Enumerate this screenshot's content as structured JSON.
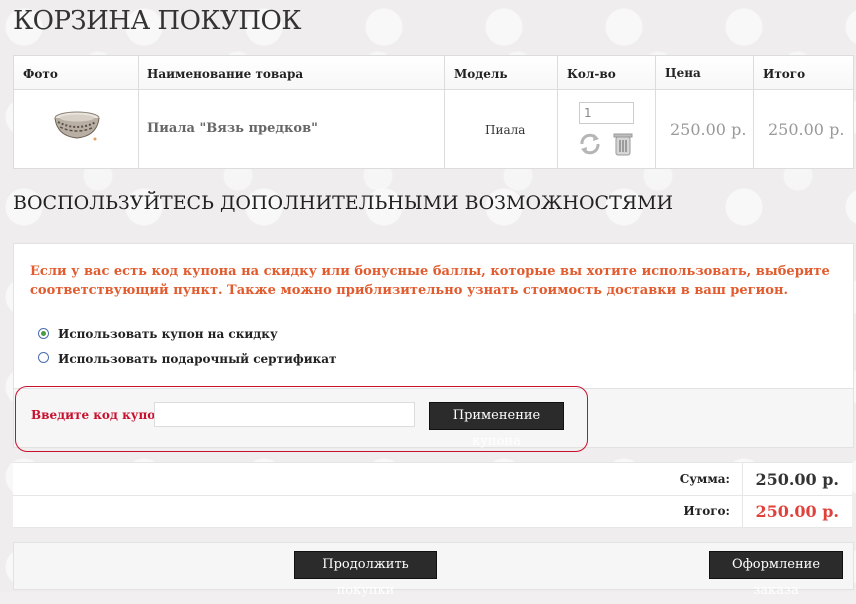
{
  "title": "КОРЗИНА ПОКУПОК",
  "cart_table": {
    "headers": [
      "Фото",
      "Наименование товара",
      "Модель",
      "Кол-во",
      "Цена",
      "Итого"
    ],
    "item": {
      "name": "Пиала \"Вязь предков\"",
      "model": "Пиала",
      "quantity": "1",
      "price": "250.00 р.",
      "total": "250.00 р.",
      "icons": [
        "refresh-icon",
        "trash-icon"
      ]
    }
  },
  "extras": {
    "heading": "ВОСПОЛЬЗУЙТЕСЬ ДОПОЛНИТЕЛЬНЫМИ ВОЗМОЖНОСТЯМИ",
    "hint": "Если у вас есть код купона на скидку или бонусные баллы, которые вы хотите использовать, выберите соответствующий пункт. Также можно приблизительно узнать стоимость доставки в ваш регион.",
    "options": [
      {
        "label": "Использовать купон на скидку",
        "selected": true
      },
      {
        "label": "Использовать подарочный сертификат",
        "selected": false
      }
    ],
    "coupon_label": "Введите код купона:",
    "coupon_value": "",
    "apply_button": "Применение купона"
  },
  "totals": {
    "sum_label": "Сумма:",
    "sum_value": "250.00 р.",
    "total_label": "Итого:",
    "total_value": "250.00 р."
  },
  "buttons": {
    "continue": "Продолжить покупки",
    "checkout": "Оформление заказа"
  },
  "colors": {
    "accent_red": "#c8102e",
    "hint_orange": "#e25b2e",
    "total_red": "#e0413a",
    "button_bg": "#2b2b2b"
  }
}
